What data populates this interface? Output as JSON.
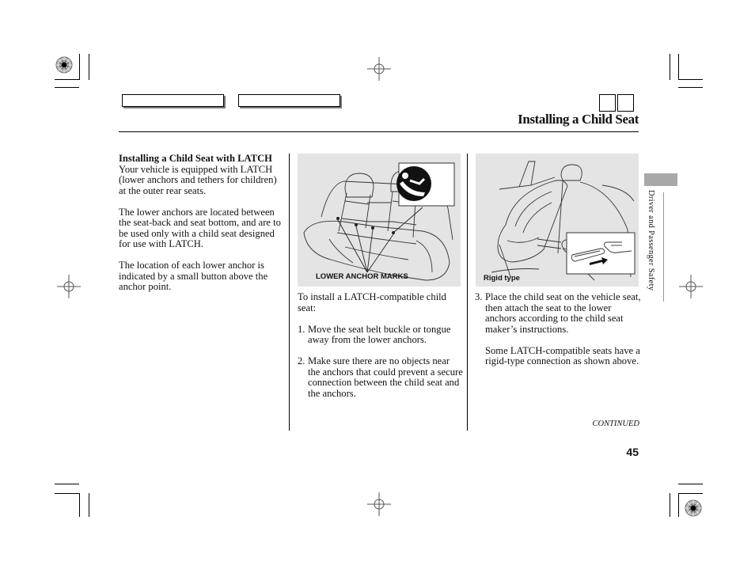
{
  "header": {
    "title": "Installing a Child Seat",
    "nav_tabs": [
      {
        "label": ""
      },
      {
        "label": ""
      }
    ]
  },
  "side_tab": {
    "section_label": "Driver and Passenger Safety",
    "tab_color": "#a8a8a8"
  },
  "column1": {
    "heading": "Installing a Child Seat with LATCH",
    "paragraphs": [
      "Your vehicle is equipped with LATCH (lower anchors and tethers for children) at the outer rear seats.",
      "The lower anchors are located between the seat-back and seat bottom, and are to be used only with a child seat designed for use with LATCH.",
      "The location of each lower anchor is indicated by a small button above the anchor point."
    ]
  },
  "column2": {
    "figure": {
      "caption": "LOWER ANCHOR MARKS",
      "icon": "child-seat-anchor-symbol"
    },
    "intro": "To install a LATCH-compatible child seat:",
    "steps": [
      {
        "num": "1.",
        "text": "Move the seat belt buckle or tongue away from the lower anchors."
      },
      {
        "num": "2.",
        "text": "Make sure there are no objects near the anchors that could prevent a secure connection between the child seat and the anchors."
      }
    ]
  },
  "column3": {
    "figure": {
      "caption": "Rigid type"
    },
    "steps": [
      {
        "num": "3.",
        "text": "Place the child seat on the vehicle seat, then attach the seat to the lower anchors according to the child seat maker’s instructions."
      }
    ],
    "note": "Some LATCH-compatible seats have a rigid-type connection as shown above.",
    "continued": "CONTINUED"
  },
  "footer": {
    "page_number": "45"
  },
  "colors": {
    "figure_background": "#e4e4e4",
    "text": "#111111"
  }
}
